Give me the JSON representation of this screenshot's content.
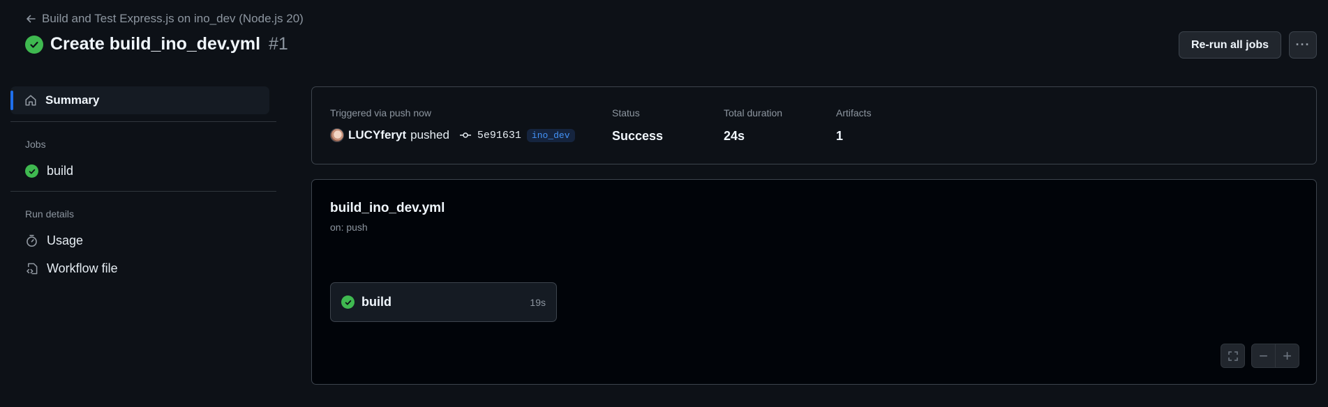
{
  "header": {
    "back_label": "Build and Test Express.js on ino_dev (Node.js 20)",
    "run_title": "Create build_ino_dev.yml",
    "run_number": "#1",
    "rerun_label": "Re-run all jobs",
    "more_label": "···",
    "status_color": "#3fb950"
  },
  "sidebar": {
    "summary_label": "Summary",
    "jobs_heading": "Jobs",
    "jobs": [
      {
        "label": "build",
        "status": "success"
      }
    ],
    "run_details_heading": "Run details",
    "details": [
      {
        "label": "Usage",
        "icon": "stopwatch-icon"
      },
      {
        "label": "Workflow file",
        "icon": "file-code-icon"
      }
    ]
  },
  "summary": {
    "trigger_label": "Triggered via push now",
    "actor": "LUCYferyt",
    "action": "pushed",
    "commit_sha": "5e91631",
    "branch": "ino_dev",
    "status_label": "Status",
    "status_value": "Success",
    "duration_label": "Total duration",
    "duration_value": "24s",
    "artifacts_label": "Artifacts",
    "artifacts_value": "1"
  },
  "workflow": {
    "file_name": "build_ino_dev.yml",
    "trigger": "on: push",
    "jobs": [
      {
        "name": "build",
        "duration": "19s",
        "status": "success"
      }
    ],
    "controls": {
      "fullscreen_icon": "fullscreen-icon",
      "zoom_out": "−",
      "zoom_in": "+"
    }
  }
}
